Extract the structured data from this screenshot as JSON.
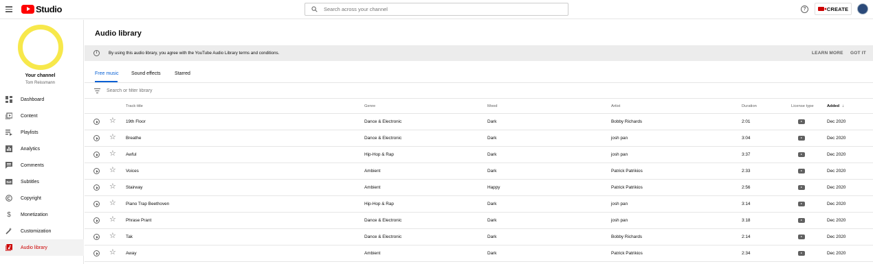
{
  "header": {
    "logo_text": "Studio",
    "search_placeholder": "Search across your channel",
    "create_label": "CREATE"
  },
  "sidebar": {
    "channel_title": "Your channel",
    "channel_name": "Tom Reissmann",
    "items": [
      {
        "label": "Dashboard",
        "icon": "dashboard-icon"
      },
      {
        "label": "Content",
        "icon": "content-icon"
      },
      {
        "label": "Playlists",
        "icon": "playlists-icon"
      },
      {
        "label": "Analytics",
        "icon": "analytics-icon"
      },
      {
        "label": "Comments",
        "icon": "comments-icon"
      },
      {
        "label": "Subtitles",
        "icon": "subtitles-icon"
      },
      {
        "label": "Copyright",
        "icon": "copyright-icon"
      },
      {
        "label": "Monetization",
        "icon": "monetization-icon"
      },
      {
        "label": "Customization",
        "icon": "customization-icon"
      },
      {
        "label": "Audio library",
        "icon": "audio-library-icon",
        "active": true
      }
    ]
  },
  "main": {
    "title": "Audio library",
    "banner": {
      "text": "By using this audio library, you agree with the YouTube Audio Library terms and conditions.",
      "learn_more": "LEARN MORE",
      "got_it": "GOT IT"
    },
    "tabs": [
      {
        "label": "Free music",
        "active": true
      },
      {
        "label": "Sound effects"
      },
      {
        "label": "Starred"
      }
    ],
    "filter_placeholder": "Search or filter library",
    "columns": {
      "track_title": "Track title",
      "genre": "Genre",
      "mood": "Mood",
      "artist": "Artist",
      "duration": "Duration",
      "license_type": "License type",
      "added": "Added"
    },
    "rows": [
      {
        "title": "19th Floor",
        "genre": "Dance & Electronic",
        "mood": "Dark",
        "artist": "Bobby Richards",
        "duration": "2:01",
        "added": "Dec 2020"
      },
      {
        "title": "Breathe",
        "genre": "Dance & Electronic",
        "mood": "Dark",
        "artist": "josh pan",
        "duration": "3:04",
        "added": "Dec 2020"
      },
      {
        "title": "Awful",
        "genre": "Hip-Hop & Rap",
        "mood": "Dark",
        "artist": "josh pan",
        "duration": "3:37",
        "added": "Dec 2020"
      },
      {
        "title": "Voices",
        "genre": "Ambient",
        "mood": "Dark",
        "artist": "Patrick Patrikios",
        "duration": "2:33",
        "added": "Dec 2020"
      },
      {
        "title": "Stairway",
        "genre": "Ambient",
        "mood": "Happy",
        "artist": "Patrick Patrikios",
        "duration": "2:56",
        "added": "Dec 2020"
      },
      {
        "title": "Piano Trap Beethoven",
        "genre": "Hip-Hop & Rap",
        "mood": "Dark",
        "artist": "josh pan",
        "duration": "3:14",
        "added": "Dec 2020"
      },
      {
        "title": "Phrase Prant",
        "genre": "Dance & Electronic",
        "mood": "Dark",
        "artist": "josh pan",
        "duration": "3:18",
        "added": "Dec 2020"
      },
      {
        "title": "Tak",
        "genre": "Dance & Electronic",
        "mood": "Dark",
        "artist": "Bobby Richards",
        "duration": "2:14",
        "added": "Dec 2020"
      },
      {
        "title": "Away",
        "genre": "Ambient",
        "mood": "Dark",
        "artist": "Patrick Patrikios",
        "duration": "2:34",
        "added": "Dec 2020"
      }
    ]
  },
  "colors": {
    "brand_red": "#ff0000",
    "active_red": "#cc0000",
    "tab_blue": "#065fd4",
    "avatar_ring": "#f7e84b"
  }
}
